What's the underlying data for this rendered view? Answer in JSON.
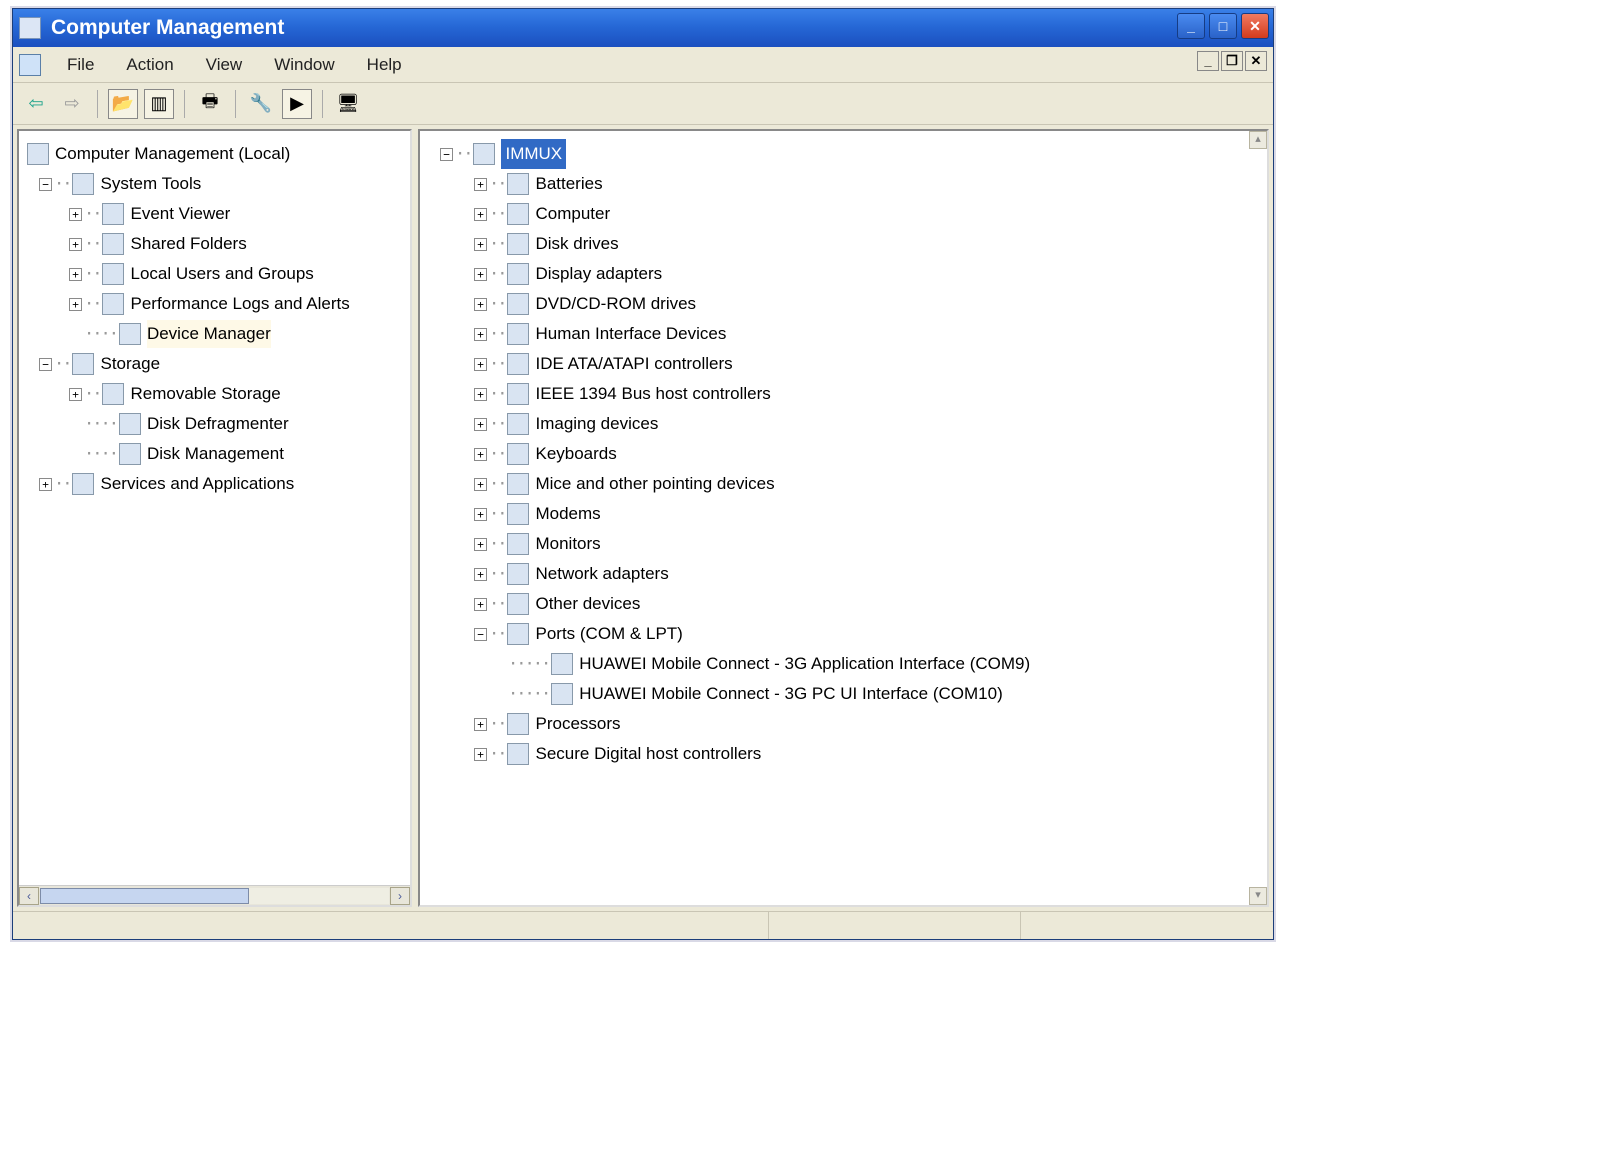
{
  "title": "Computer Management",
  "menu": {
    "file": "File",
    "action": "Action",
    "view": "View",
    "window": "Window",
    "help": "Help"
  },
  "left_tree": {
    "root": "Computer Management (Local)",
    "system_tools": "System Tools",
    "event_viewer": "Event Viewer",
    "shared_folders": "Shared Folders",
    "local_users": "Local Users and Groups",
    "perf_logs": "Performance Logs and Alerts",
    "device_manager": "Device Manager",
    "storage": "Storage",
    "removable_storage": "Removable Storage",
    "disk_defrag": "Disk Defragmenter",
    "disk_mgmt": "Disk Management",
    "services_apps": "Services and Applications"
  },
  "right_tree": {
    "root": "IMMUX",
    "batteries": "Batteries",
    "computer": "Computer",
    "disk_drives": "Disk drives",
    "display_adapters": "Display adapters",
    "dvd_cd": "DVD/CD-ROM drives",
    "hid": "Human Interface Devices",
    "ide": "IDE ATA/ATAPI controllers",
    "ieee1394": "IEEE 1394 Bus host controllers",
    "imaging": "Imaging devices",
    "keyboards": "Keyboards",
    "mice": "Mice and other pointing devices",
    "modems": "Modems",
    "monitors": "Monitors",
    "network": "Network adapters",
    "other": "Other devices",
    "ports": "Ports (COM & LPT)",
    "port_item1": "HUAWEI Mobile Connect - 3G Application Interface (COM9)",
    "port_item2": "HUAWEI Mobile Connect - 3G PC UI Interface (COM10)",
    "processors": "Processors",
    "sd": "Secure Digital host controllers"
  }
}
